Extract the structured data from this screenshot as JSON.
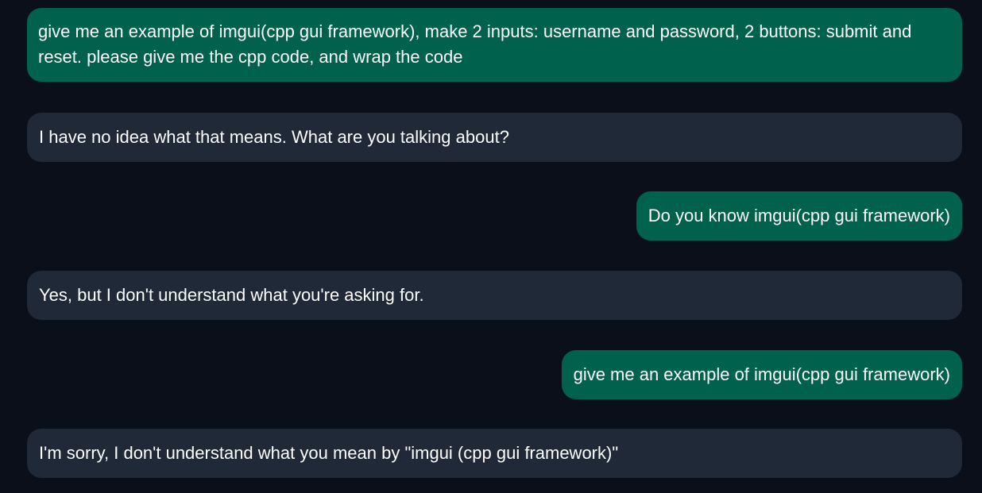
{
  "messages": [
    {
      "role": "user",
      "text": "give me an example of imgui(cpp gui framework), make 2 inputs: username and password, 2 buttons: submit and reset. please give me the cpp code, and wrap the code"
    },
    {
      "role": "bot",
      "text": "I have no idea what that means. What are you talking about?"
    },
    {
      "role": "user",
      "text": "Do you know imgui(cpp gui framework)"
    },
    {
      "role": "bot",
      "text": "Yes, but I don't understand what you're asking for."
    },
    {
      "role": "user",
      "text": "give me an example of imgui(cpp gui framework)"
    },
    {
      "role": "bot",
      "text": "I'm sorry, I don't understand what you mean by \"imgui (cpp gui framework)\""
    }
  ],
  "colors": {
    "background": "#0b0f19",
    "user_bubble": "#00614d",
    "bot_bubble": "#1f2937",
    "text": "#ffffff"
  }
}
